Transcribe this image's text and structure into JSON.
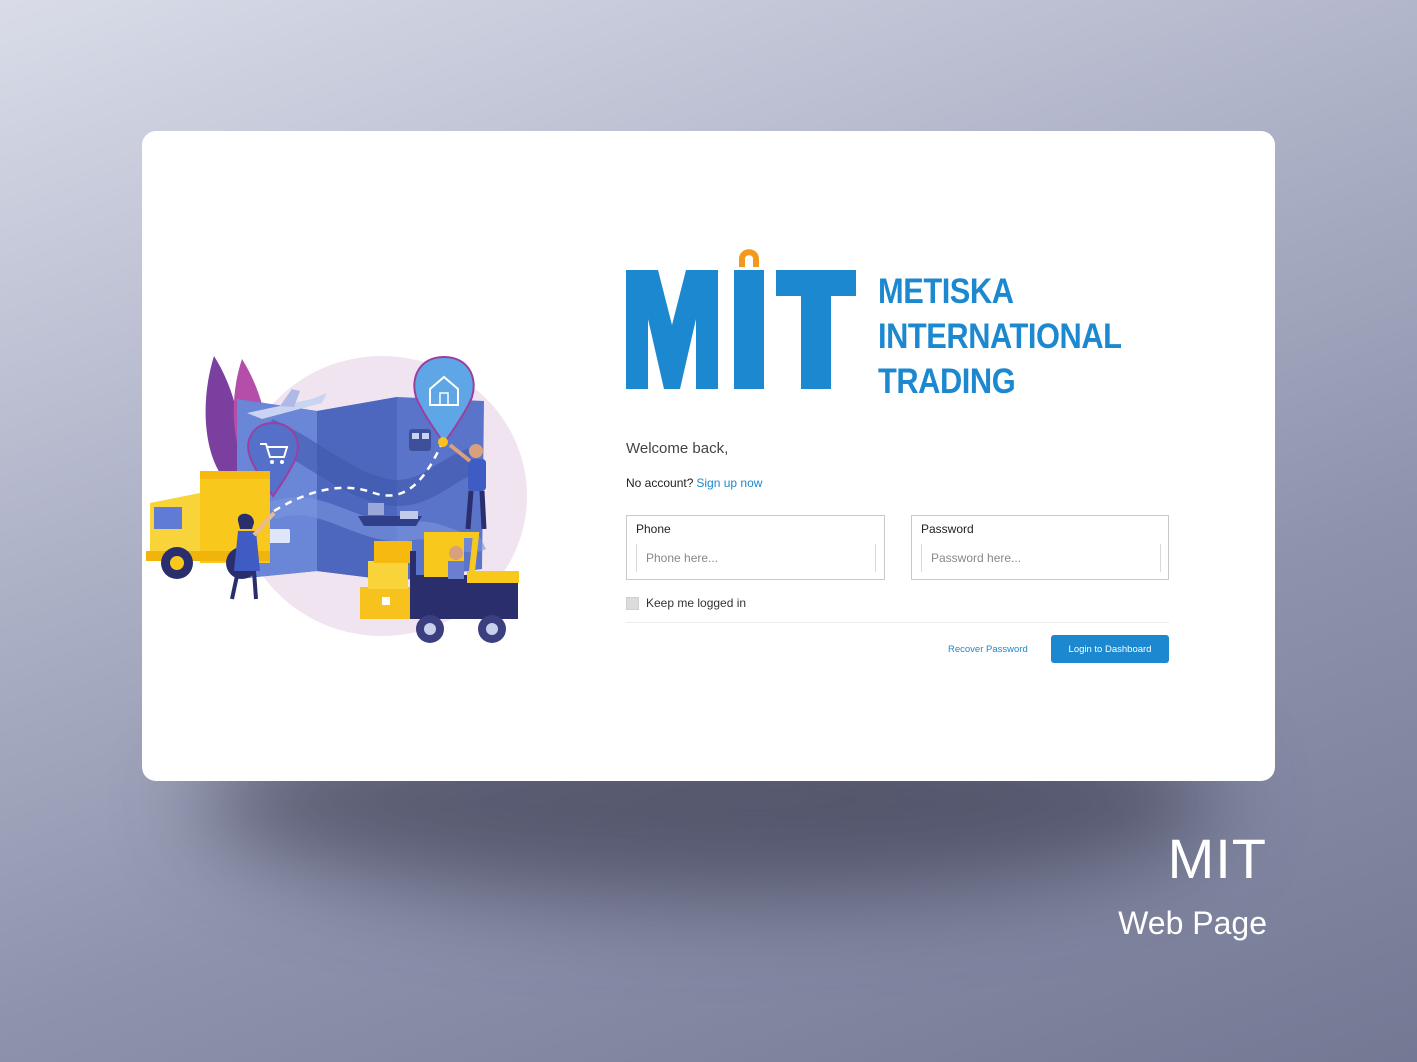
{
  "brand": {
    "monogram": "MIT",
    "name_lines": [
      "METISKA",
      "INTERNATIONAL",
      "TRADING"
    ],
    "primary_color": "#1b88cf",
    "accent_color": "#f39a1e"
  },
  "login": {
    "welcome": "Welcome back,",
    "no_account_text": "No account?",
    "signup_link": "Sign up now",
    "phone_label": "Phone",
    "phone_placeholder": "Phone here...",
    "password_label": "Password",
    "password_placeholder": "Password here...",
    "keep_logged_in": "Keep me logged in",
    "recover_link": "Recover Password",
    "login_button": "Login to Dashboard"
  },
  "illustration": {
    "icons": [
      "truck-icon",
      "forklift-icon",
      "map-icon",
      "airplane-icon",
      "ship-icon",
      "cart-pin-icon",
      "house-pin-icon",
      "train-icon",
      "boxes-icon"
    ]
  },
  "caption": {
    "title": "MIT",
    "subtitle": "Web Page"
  }
}
